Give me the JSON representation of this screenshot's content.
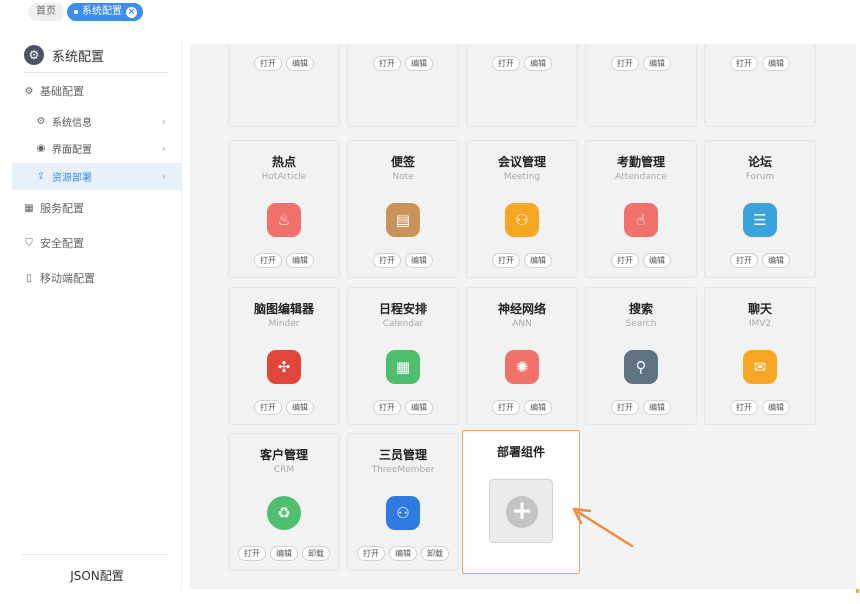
{
  "tabs": {
    "home": "首页",
    "active": "系统配置",
    "close_icon": "close-circle-icon"
  },
  "sidebar": {
    "header": "系统配置",
    "items": [
      {
        "label": "基础配置",
        "icon": "gear-icon",
        "level": 1
      },
      {
        "label": "系统信息",
        "icon": "gear-icon",
        "level": 2
      },
      {
        "label": "界面配置",
        "icon": "palette-icon",
        "level": 2
      },
      {
        "label": "资源部署",
        "icon": "upload-icon",
        "level": 2,
        "active": true
      },
      {
        "label": "服务配置",
        "icon": "server-icon",
        "level": 1
      },
      {
        "label": "安全配置",
        "icon": "shield-icon",
        "level": 1
      },
      {
        "label": "移动端配置",
        "icon": "mobile-icon",
        "level": 1
      }
    ],
    "footer": "JSON配置"
  },
  "buttons": {
    "open": "打开",
    "edit": "编辑",
    "uninstall": "卸载"
  },
  "top_cards": [
    {
      "icon": "user-settings-icon",
      "color": "#607480"
    },
    {
      "icon": "newspaper-icon",
      "color": "#5cc47d"
    },
    {
      "icon": "dashboard-icon",
      "color": "#3d86e4"
    },
    {
      "icon": "presentation-icon",
      "color": "#3d86e4"
    },
    {
      "icon": "home-icon",
      "color": "#3d86e4"
    }
  ],
  "cards": [
    {
      "name": "热点",
      "en": "HotArticle",
      "icon": "flame-icon",
      "color": "#f2716b"
    },
    {
      "name": "便签",
      "en": "Note",
      "icon": "note-icon",
      "color": "#c9935a"
    },
    {
      "name": "会议管理",
      "en": "Meeting",
      "icon": "meeting-icon",
      "color": "#f5a623"
    },
    {
      "name": "考勤管理",
      "en": "Attendance",
      "icon": "hand-pointer-icon",
      "color": "#f2716b"
    },
    {
      "name": "论坛",
      "en": "Forum",
      "icon": "forum-icon",
      "color": "#3aa2dc"
    },
    {
      "name": "脑图编辑器",
      "en": "Minder",
      "icon": "mindmap-icon",
      "color": "#e0453a"
    },
    {
      "name": "日程安排",
      "en": "Calendar",
      "icon": "calendar-icon",
      "color": "#4fbe6e"
    },
    {
      "name": "神经网络",
      "en": "ANN",
      "icon": "brain-icon",
      "color": "#f2716b"
    },
    {
      "name": "搜索",
      "en": "Search",
      "icon": "search-icon",
      "color": "#5f7380"
    },
    {
      "name": "聊天",
      "en": "IMV2",
      "icon": "chat-icon",
      "color": "#f5a623"
    },
    {
      "name": "客户管理",
      "en": "CRM",
      "icon": "crm-cycle-icon",
      "color": "#4fbe6e",
      "uninstall": true
    },
    {
      "name": "三员管理",
      "en": "ThreeMember",
      "icon": "org-chart-icon",
      "color": "#2f7be0",
      "uninstall": true
    }
  ],
  "deploy": {
    "title": "部署组件",
    "icon": "plus-icon"
  }
}
